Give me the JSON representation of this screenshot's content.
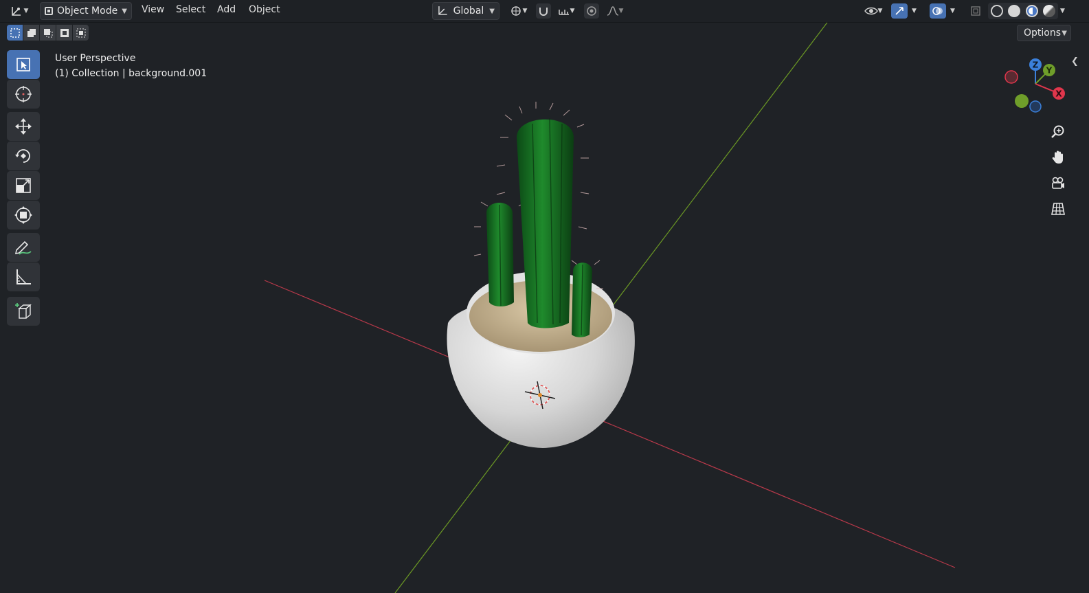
{
  "header": {
    "editor_type_icon": "viewport-editor-icon",
    "mode": "Object Mode",
    "menus": [
      "View",
      "Select",
      "Add",
      "Object"
    ],
    "orientation": "Global",
    "options_label": "Options"
  },
  "viewport": {
    "perspective_label": "User Perspective",
    "collection_label": "(1) Collection | background.001"
  },
  "gizmo": {
    "axes": [
      "Z",
      "Y",
      "X"
    ],
    "colors": {
      "x": "#e0364c",
      "y": "#6f9e2a",
      "z": "#3b80db"
    }
  },
  "toolbar": {
    "tools": [
      "select-box",
      "cursor",
      "move",
      "rotate",
      "scale",
      "transform",
      "annotate",
      "measure",
      "add-cube"
    ]
  },
  "colors": {
    "accent": "#4772b3",
    "x_axis_line": "#b8394a",
    "y_axis_line": "#6c9a24",
    "background": "#1f2226"
  }
}
